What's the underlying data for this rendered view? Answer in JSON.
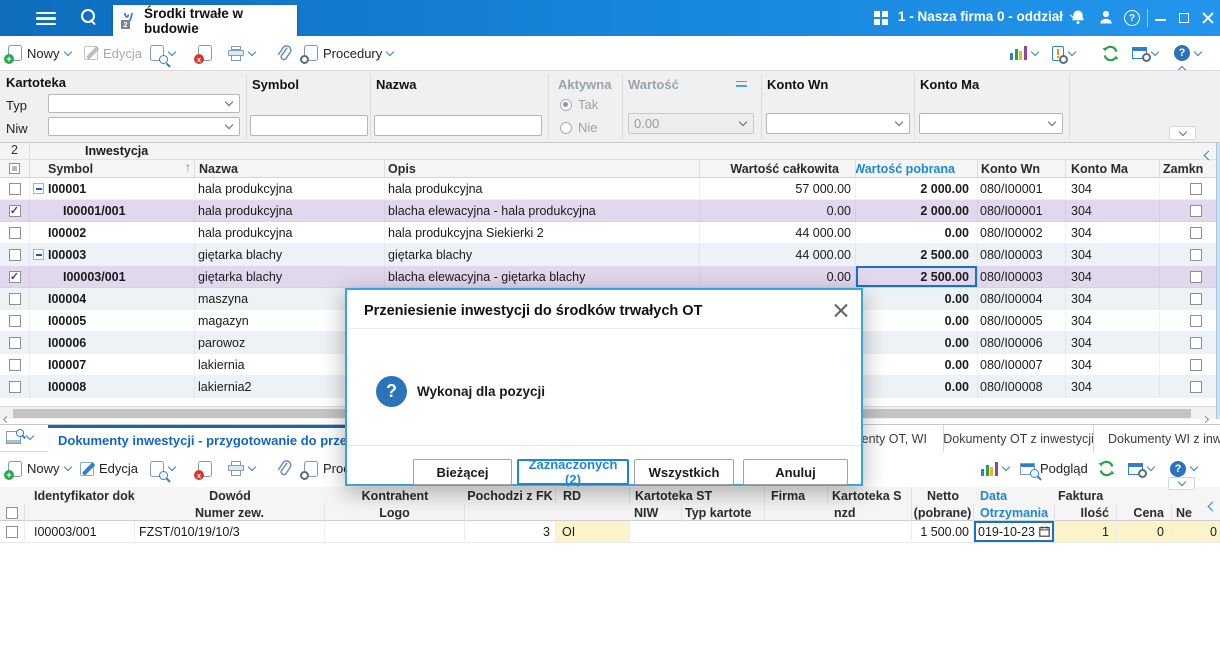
{
  "titlebar": {
    "tab": {
      "title": "Środki trwałe w budowie",
      "badge": "2"
    },
    "company": "1 - Nasza firma 0 - oddział"
  },
  "toolbar": {
    "new": "Nowy",
    "edit": "Edycja",
    "procedures": "Procedury",
    "preview": "Podgląd"
  },
  "filters": {
    "kartoteka": "Kartoteka",
    "typ": "Typ",
    "niw": "Niw",
    "symbol": "Symbol",
    "nazwa": "Nazwa",
    "aktywna": "Aktywna",
    "tak": "Tak",
    "nie": "Nie",
    "wartosc": "Wartość",
    "wartosc_value": "0.00",
    "konto_wn": "Konto Wn",
    "konto_ma": "Konto Ma"
  },
  "main_table": {
    "count": "2",
    "group": "Inwestycja",
    "headers": {
      "symbol": "Symbol",
      "nazwa": "Nazwa",
      "opis": "Opis",
      "total": "Wartość całkowita",
      "pobrana": "Wartość pobrana",
      "wn": "Konto Wn",
      "ma": "Konto Ma",
      "zamk": "Zamkn"
    },
    "rows": [
      {
        "symbol": "I00001",
        "expand": true,
        "child": false,
        "checked": false,
        "focus": false,
        "nazwa": "hala produkcyjna",
        "opis": "hala produkcyjna",
        "total": "57 000.00",
        "pobrana": "2 000.00",
        "wn": "080/I00001",
        "ma": "304"
      },
      {
        "symbol": "I00001/001",
        "expand": false,
        "child": true,
        "checked": true,
        "focus": false,
        "nazwa": "hala produkcyjna",
        "opis": "blacha elewacyjna - hala produkcyjna",
        "total": "0.00",
        "pobrana": "2 000.00",
        "wn": "080/I00001",
        "ma": "304"
      },
      {
        "symbol": "I00002",
        "expand": false,
        "child": false,
        "checked": false,
        "focus": false,
        "nazwa": "hala produkcyjna",
        "opis": "hala produkcyjna Siekierki 2",
        "total": "44 000.00",
        "pobrana": "0.00",
        "wn": "080/I00002",
        "ma": "304"
      },
      {
        "symbol": "I00003",
        "expand": true,
        "child": false,
        "checked": false,
        "focus": false,
        "nazwa": "giętarka blachy",
        "opis": "giętarka blachy",
        "total": "44 000.00",
        "pobrana": "2 500.00",
        "wn": "080/I00003",
        "ma": "304"
      },
      {
        "symbol": "I00003/001",
        "expand": false,
        "child": true,
        "checked": true,
        "focus": true,
        "nazwa": "giętarka blachy",
        "opis": "blacha elewacyjna - giętarka blachy",
        "total": "0.00",
        "pobrana": "2 500.00",
        "wn": "080/I00003",
        "ma": "304"
      },
      {
        "symbol": "I00004",
        "expand": false,
        "child": false,
        "checked": false,
        "focus": false,
        "nazwa": "maszyna",
        "opis": "",
        "total": "",
        "pobrana": "0.00",
        "wn": "080/I00004",
        "ma": "304"
      },
      {
        "symbol": "I00005",
        "expand": false,
        "child": false,
        "checked": false,
        "focus": false,
        "nazwa": "magazyn",
        "opis": "",
        "total": "",
        "pobrana": "0.00",
        "wn": "080/I00005",
        "ma": "304"
      },
      {
        "symbol": "I00006",
        "expand": false,
        "child": false,
        "checked": false,
        "focus": false,
        "nazwa": "parowoz",
        "opis": "",
        "total": "",
        "pobrana": "0.00",
        "wn": "080/I00006",
        "ma": "304"
      },
      {
        "symbol": "I00007",
        "expand": false,
        "child": false,
        "checked": false,
        "focus": false,
        "nazwa": "lakiernia",
        "opis": "",
        "total": "",
        "pobrana": "0.00",
        "wn": "080/I00007",
        "ma": "304"
      },
      {
        "symbol": "I00008",
        "expand": false,
        "child": false,
        "checked": false,
        "focus": false,
        "nazwa": "lakiernia2",
        "opis": "",
        "total": "",
        "pobrana": "0.00",
        "wn": "080/I00008",
        "ma": "304"
      }
    ]
  },
  "modal": {
    "title": "Przeniesienie inwestycji do środków trwałych OT",
    "message": "Wykonaj dla pozycji",
    "buttons": {
      "current": "Bieżącej",
      "selected": "Zaznaczonych (2)",
      "all": "Wszystkich",
      "cancel": "Anuluj"
    }
  },
  "bottom": {
    "tabs": {
      "active": "Dokumenty inwestycji - przygotowanie do przeniesi",
      "t2": "Dokumenty OT, WI",
      "t3": "Dokumenty OT z inwestycji",
      "t4": "Dokumenty WI z inwestycji"
    },
    "headers": {
      "id": "Identyfikator dokument",
      "dowod": "Dowód",
      "numer": "Numer zew.",
      "kontrahent": "Kontrahent",
      "logo": "Logo",
      "pochodzi": "Pochodzi z FK",
      "rd": "RD",
      "kart_st": "Kartoteka ST",
      "niw": "NIW",
      "typ": "Typ kartote",
      "firma": "Firma",
      "kart_s": "Kartoteka S",
      "nzd": "nzd",
      "netto": "Netto",
      "pobrane": "(pobrane)",
      "data": "Data",
      "otrzymania": "Otrzymania",
      "faktura": "Faktura",
      "ilosc": "Ilość",
      "cena": "Cena",
      "ne": "Ne"
    },
    "row": {
      "id": "I00003/001",
      "dowod": "FZST/010/19/10/3",
      "pochodzi": "3",
      "rd": "OI",
      "netto": "1 500.00",
      "data": "019-10-23",
      "ilosc": "1",
      "cena": "0",
      "ne": "0"
    }
  },
  "colors": {
    "accent": "#1e87d3",
    "titlebar": "#1373c8",
    "selected_row": "#e2d8ee",
    "focus_border": "#1774c5",
    "yellow_cell": "#fbf3c9",
    "modal_border": "#36a6da",
    "active_tab": "#1565c0"
  }
}
